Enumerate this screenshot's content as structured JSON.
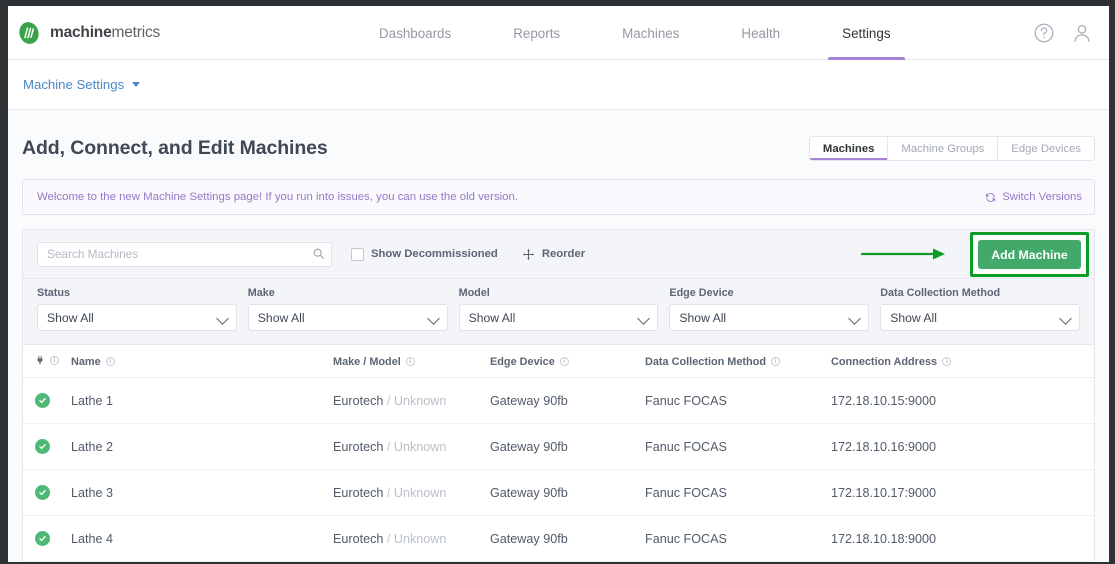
{
  "brand": {
    "name_bold": "machine",
    "name_light": "metrics",
    "logo_icon": "machinemetrics-leaf-logo",
    "accent_green": "#3aa34a",
    "accent_purple": "#a683d4"
  },
  "topnav": {
    "items": [
      {
        "label": "Dashboards",
        "active": false
      },
      {
        "label": "Reports",
        "active": false
      },
      {
        "label": "Machines",
        "active": false
      },
      {
        "label": "Health",
        "active": false
      },
      {
        "label": "Settings",
        "active": true
      }
    ],
    "help_icon": "help-circle-icon",
    "account_icon": "user-account-icon"
  },
  "breadcrumb": {
    "label": "Machine Settings",
    "caret_icon": "caret-down-icon"
  },
  "page": {
    "title": "Add, Connect, and Edit Machines",
    "view_tabs": [
      {
        "label": "Machines",
        "active": true
      },
      {
        "label": "Machine Groups",
        "active": false
      },
      {
        "label": "Edge Devices",
        "active": false
      }
    ]
  },
  "banner": {
    "message": "Welcome to the new Machine Settings page! If you run into issues, you can use the old version.",
    "switch_label": "Switch Versions",
    "switch_icon": "sync-arrows-icon"
  },
  "toolbar": {
    "search_placeholder": "Search Machines",
    "search_value": "",
    "search_icon": "search-icon",
    "show_decommissioned_label": "Show Decommissioned",
    "show_decommissioned_checked": false,
    "reorder_label": "Reorder",
    "reorder_icon": "move-arrows-icon",
    "add_machine_label": "Add Machine",
    "annotation_arrow_icon": "green-arrow-right-annotation",
    "annotation_highlight_color": "#0b9c28"
  },
  "filters": [
    {
      "label": "Status",
      "value": "Show All"
    },
    {
      "label": "Make",
      "value": "Show All"
    },
    {
      "label": "Model",
      "value": "Show All"
    },
    {
      "label": "Edge Device",
      "value": "Show All"
    },
    {
      "label": "Data Collection Method",
      "value": "Show All"
    }
  ],
  "table": {
    "headers": [
      {
        "label": "",
        "icon": "plug-icon",
        "info": true
      },
      {
        "label": "Name",
        "info": true
      },
      {
        "label": "Make / Model",
        "info": true
      },
      {
        "label": "Edge Device",
        "info": true
      },
      {
        "label": "Data Collection Method",
        "info": true
      },
      {
        "label": "Connection Address",
        "info": true
      }
    ],
    "rows": [
      {
        "status_icon": "status-connected-check-icon",
        "name": "Lathe 1",
        "make": "Eurotech",
        "separator": "/",
        "model": "Unknown",
        "edge_device": "Gateway 90fb",
        "data_collection_method": "Fanuc FOCAS",
        "connection_address": "172.18.10.15:9000"
      },
      {
        "status_icon": "status-connected-check-icon",
        "name": "Lathe 2",
        "make": "Eurotech",
        "separator": "/",
        "model": "Unknown",
        "edge_device": "Gateway 90fb",
        "data_collection_method": "Fanuc FOCAS",
        "connection_address": "172.18.10.16:9000"
      },
      {
        "status_icon": "status-connected-check-icon",
        "name": "Lathe 3",
        "make": "Eurotech",
        "separator": "/",
        "model": "Unknown",
        "edge_device": "Gateway 90fb",
        "data_collection_method": "Fanuc FOCAS",
        "connection_address": "172.18.10.17:9000"
      },
      {
        "status_icon": "status-connected-check-icon",
        "name": "Lathe 4",
        "make": "Eurotech",
        "separator": "/",
        "model": "Unknown",
        "edge_device": "Gateway 90fb",
        "data_collection_method": "Fanuc FOCAS",
        "connection_address": "172.18.10.18:9000"
      }
    ]
  }
}
